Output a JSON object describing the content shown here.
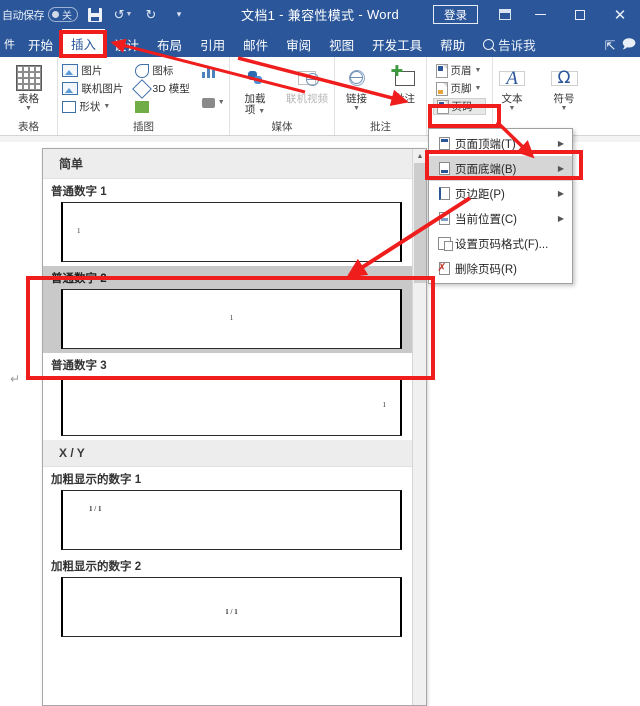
{
  "titlebar": {
    "autosave_label": "自动保存",
    "autosave_state": "关",
    "save_icon": "save-icon",
    "undo_icon": "undo-icon",
    "redo_icon": "redo-icon",
    "customize_icon": "customize-quick-access-icon",
    "doc_name": "文档1",
    "sep1": "-",
    "compat_mode": "兼容性模式",
    "sep2": "-",
    "app_name": "Word",
    "signin_label": "登录",
    "ribbon_display_icon": "ribbon-display-options-icon",
    "minimize_icon": "minimize-icon",
    "maximize_icon": "maximize-icon",
    "close_icon": "close-icon"
  },
  "tabs": [
    {
      "label": "件",
      "name": "file-tab"
    },
    {
      "label": "开始",
      "name": "tab-home"
    },
    {
      "label": "插入",
      "name": "tab-insert",
      "active": true
    },
    {
      "label": "设计",
      "name": "tab-design"
    },
    {
      "label": "布局",
      "name": "tab-layout"
    },
    {
      "label": "引用",
      "name": "tab-references"
    },
    {
      "label": "邮件",
      "name": "tab-mailings"
    },
    {
      "label": "审阅",
      "name": "tab-review"
    },
    {
      "label": "视图",
      "name": "tab-view"
    },
    {
      "label": "开发工具",
      "name": "tab-developer"
    },
    {
      "label": "帮助",
      "name": "tab-help"
    }
  ],
  "tellme": {
    "label": "告诉我"
  },
  "tab_right": {
    "share_icon": "share-icon",
    "comments_icon": "comments-icon"
  },
  "ribbon": {
    "groups": [
      {
        "name": "group-tables",
        "label": "表格",
        "buttons": [
          {
            "name": "table-button",
            "cap1": "表格",
            "cap2": "",
            "dropdown": true,
            "icon": "table-icon"
          }
        ]
      },
      {
        "name": "group-illustrations",
        "label": "插图",
        "small": [
          {
            "name": "pictures-button",
            "label": "图片",
            "icon": "picture-icon",
            "dropdown": false
          },
          {
            "name": "online-pictures-button",
            "label": "联机图片",
            "icon": "online-picture-icon",
            "dropdown": false
          },
          {
            "name": "shapes-button",
            "label": "形状",
            "icon": "shapes-icon",
            "dropdown": true
          }
        ],
        "small2": [
          {
            "name": "icons-button",
            "label": "图标",
            "icon": "icons-icon",
            "dropdown": false
          },
          {
            "name": "model3d-button",
            "label": "3D 模型",
            "icon": "3d-model-icon",
            "dropdown": false
          },
          {
            "name": "smartart-button",
            "label": "",
            "icon": "smartart-icon",
            "dropdown": false
          }
        ],
        "tail": [
          {
            "name": "chart-button",
            "label": "",
            "icon": "chart-icon"
          },
          {
            "name": "screenshot-button",
            "label": "",
            "icon": "screenshot-icon",
            "dropdown": true
          }
        ]
      },
      {
        "name": "group-media",
        "label": "媒体",
        "buttons": [
          {
            "name": "addins-button",
            "cap1": "加载",
            "cap2": "项",
            "dropdown": true,
            "icon": "add-ins-icon"
          },
          {
            "name": "online-video-button",
            "cap1": "联机视频",
            "cap2": "",
            "dropdown": false,
            "icon": "online-video-icon",
            "disabled": true
          }
        ]
      },
      {
        "name": "group-comments",
        "label": "批注",
        "buttons": [
          {
            "name": "link-button",
            "cap1": "链接",
            "cap2": "",
            "dropdown": true,
            "icon": "link-icon"
          },
          {
            "name": "comment-button",
            "cap1": "批注",
            "cap2": "",
            "dropdown": false,
            "icon": "new-comment-icon"
          }
        ]
      },
      {
        "name": "group-header-footer",
        "label": "",
        "small": [
          {
            "name": "header-button",
            "label": "页眉",
            "icon": "header-icon",
            "dropdown": true
          },
          {
            "name": "footer-button",
            "label": "页脚",
            "icon": "footer-icon",
            "dropdown": true
          },
          {
            "name": "page-number-button",
            "label": "页码",
            "icon": "page-number-icon",
            "dropdown": true,
            "highlighted": true
          }
        ]
      },
      {
        "name": "group-text",
        "label": "",
        "buttons": [
          {
            "name": "text-button",
            "cap1": "文本",
            "cap2": "",
            "dropdown": true,
            "icon": "text-A-icon"
          },
          {
            "name": "symbol-button",
            "cap1": "符号",
            "cap2": "",
            "dropdown": true,
            "icon": "omega-symbol-icon"
          }
        ]
      }
    ]
  },
  "page_number_menu": {
    "items": [
      {
        "name": "menu-page-top",
        "label": "页面顶端(T)",
        "icon": "page-top-icon",
        "submenu": true,
        "highlighted": false
      },
      {
        "name": "menu-page-bottom",
        "label": "页面底端(B)",
        "icon": "page-bottom-icon",
        "submenu": true,
        "highlighted": true
      },
      {
        "name": "menu-page-margins",
        "label": "页边距(P)",
        "icon": "page-margins-icon",
        "submenu": true,
        "highlighted": false
      },
      {
        "name": "menu-current-position",
        "label": "当前位置(C)",
        "icon": "current-position-icon",
        "submenu": true,
        "highlighted": false
      },
      {
        "name": "menu-format-page-numbers",
        "label": "设置页码格式(F)...",
        "icon": "format-page-number-icon",
        "submenu": false,
        "highlighted": false
      },
      {
        "name": "menu-remove-page-numbers",
        "label": "删除页码(R)",
        "icon": "remove-page-number-icon",
        "submenu": false,
        "highlighted": false
      }
    ]
  },
  "gallery": {
    "scroll_up_icon": "scroll-up-arrow-icon",
    "sections": [
      {
        "name": "gallery-section-simple",
        "header": "简单",
        "items": [
          {
            "name": "gallery-item-plain-number-1",
            "title": "普通数字 1",
            "number": "1",
            "align": "left",
            "selected": false
          },
          {
            "name": "gallery-item-plain-number-2",
            "title": "普通数字 2",
            "number": "1",
            "align": "center",
            "selected": true
          },
          {
            "name": "gallery-item-plain-number-3",
            "title": "普通数字 3",
            "number": "1",
            "align": "right",
            "selected": false
          }
        ]
      },
      {
        "name": "gallery-section-xy",
        "header": "X / Y",
        "items": [
          {
            "name": "gallery-item-bold-number-1",
            "title": "加粗显示的数字 1",
            "number": "1 / 1",
            "align": "bleft",
            "selected": false
          },
          {
            "name": "gallery-item-bold-number-2",
            "title": "加粗显示的数字 2",
            "number": "1 / 1",
            "align": "bcenter",
            "selected": false
          }
        ]
      }
    ]
  },
  "document": {
    "paragraph_mark": "↵"
  },
  "annotations": {
    "accent_color": "#f01d1d",
    "boxes": [
      {
        "name": "highlight-insert-tab"
      },
      {
        "name": "highlight-page-number-button"
      },
      {
        "name": "highlight-page-bottom-menu-item"
      },
      {
        "name": "highlight-plain-number-2-gallery-item"
      }
    ],
    "arrows": [
      {
        "name": "arrow-to-insert-tab"
      },
      {
        "name": "arrow-to-page-number-button"
      },
      {
        "name": "arrow-to-page-bottom-item"
      },
      {
        "name": "arrow-to-plain-number-2"
      }
    ]
  }
}
